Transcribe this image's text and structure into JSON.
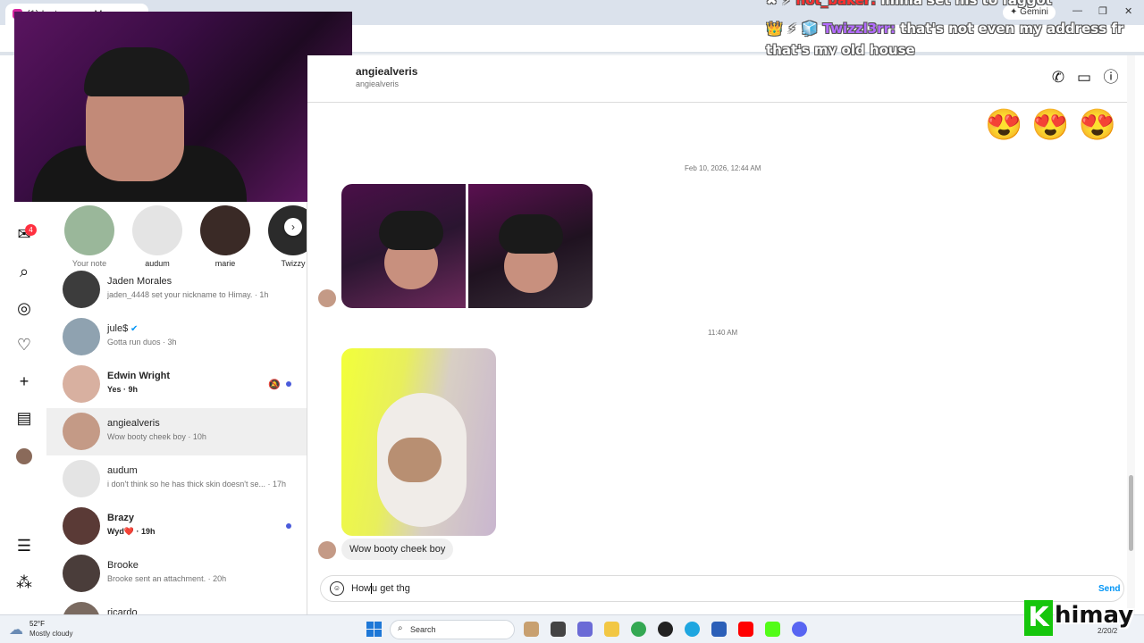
{
  "browser": {
    "tab_title": "(1) Instagram • Messages",
    "gemini_label": "Gemini",
    "window_controls": [
      "—",
      "❐",
      "✕"
    ]
  },
  "stream_chat": {
    "line1_user": "not_baker:",
    "line1_text": "imma set his to faggot",
    "line2_user": "Twizzl3rr:",
    "line2_text": "that's not even my address fr that's my old house"
  },
  "notes": [
    {
      "label": "Your note",
      "color": "#9ab79a"
    },
    {
      "label": "audum",
      "color": "#e4e4e4"
    },
    {
      "label": "marie",
      "color": "#3a2a26"
    },
    {
      "label": "Twizzy",
      "color": "#2b2b2b"
    }
  ],
  "nav": {
    "badge": "4"
  },
  "conversations": [
    {
      "name": "Jaden Morales",
      "sub": "jaden_4448 set your nickname to Himay. · 1h",
      "color": "#3c3c3c",
      "bold": false,
      "unread": false,
      "muted": false,
      "verified": false,
      "active": false
    },
    {
      "name": "jule$",
      "sub": "Gotta run duos · 3h",
      "color": "#8fa2b0",
      "bold": false,
      "unread": false,
      "muted": false,
      "verified": true,
      "active": false
    },
    {
      "name": "Edwin Wright",
      "sub": "Yes · 9h",
      "color": "#d8b0a0",
      "bold": true,
      "unread": true,
      "muted": true,
      "verified": false,
      "active": false
    },
    {
      "name": "angiealveris",
      "sub": "Wow booty cheek boy · 10h",
      "color": "#c49a86",
      "bold": false,
      "unread": false,
      "muted": false,
      "verified": false,
      "active": true
    },
    {
      "name": "audum",
      "sub": "i don't think so he has thick skin doesn't se... · 17h",
      "color": "#e4e4e4",
      "bold": false,
      "unread": false,
      "muted": false,
      "verified": false,
      "active": false
    },
    {
      "name": "Brazy",
      "sub": "Wyd❤️ · 19h",
      "color": "#5a3a36",
      "bold": true,
      "unread": true,
      "muted": false,
      "verified": false,
      "active": false
    },
    {
      "name": "Brooke",
      "sub": "Brooke sent an attachment. · 20h",
      "color": "#4a3d3a",
      "bold": false,
      "unread": false,
      "muted": false,
      "verified": false,
      "active": false
    },
    {
      "name": "ricardo",
      "sub": "",
      "color": "#7a6a60",
      "bold": false,
      "unread": false,
      "muted": false,
      "verified": false,
      "active": false
    }
  ],
  "thread": {
    "name": "angiealveris",
    "username": "angiealveris",
    "emojis": "😍😍😍",
    "timestamp1": "Feb 10, 2026, 12:44 AM",
    "timestamp2": "11:40 AM",
    "message": "Wow booty cheek boy",
    "compose_value": "How",
    "compose_value_after": "u get thg",
    "send_label": "Send"
  },
  "taskbar": {
    "temp": "52°F",
    "condition": "Mostly cloudy",
    "search_placeholder": "Search",
    "date": "2/20/2"
  },
  "logo": {
    "k": "K",
    "text": "himay"
  }
}
